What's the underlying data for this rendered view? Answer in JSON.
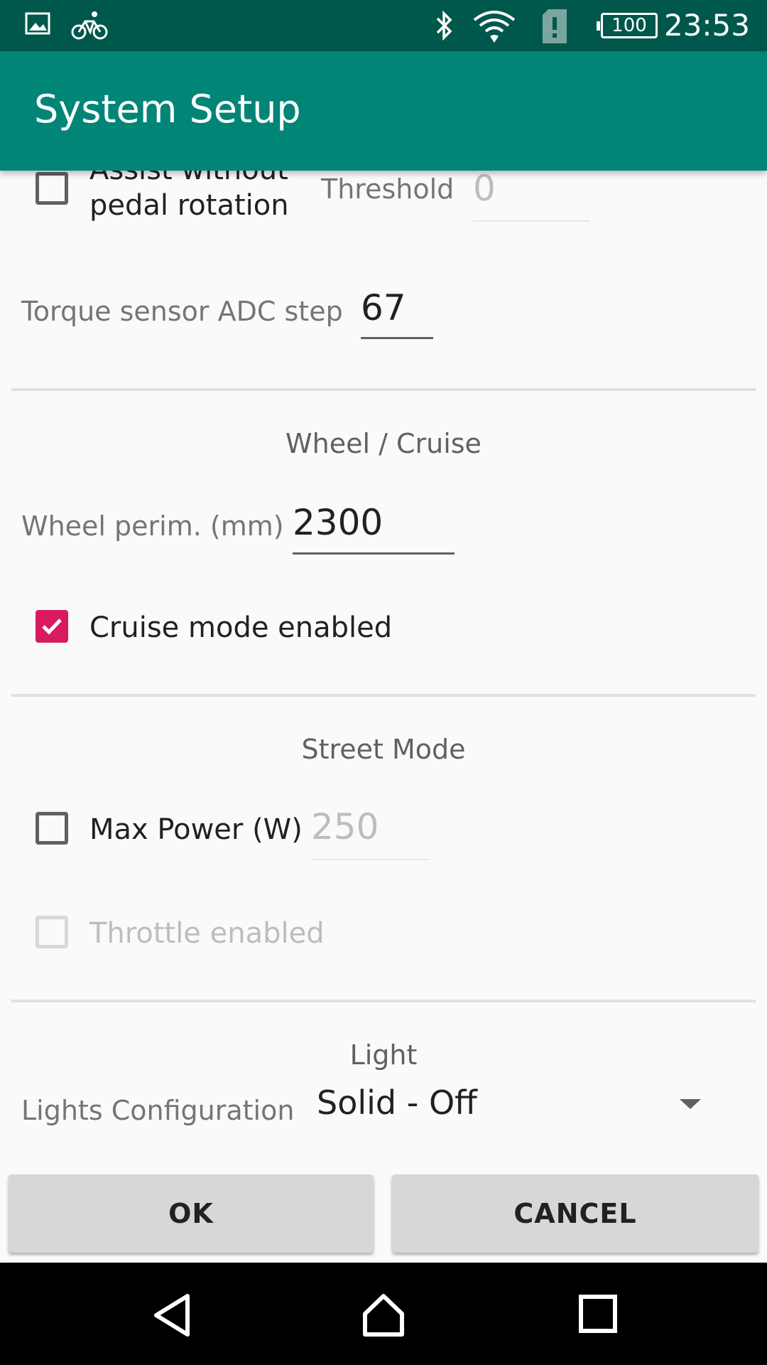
{
  "status_bar": {
    "icons_left": [
      "image-icon",
      "bicycle-icon"
    ],
    "icons_right": [
      "bluetooth-icon",
      "wifi-icon",
      "sim-alert-icon",
      "battery-icon"
    ],
    "battery_level": "100",
    "time": "23:53"
  },
  "app_bar": {
    "title": "System Setup"
  },
  "sections": {
    "torque": {
      "assist_label": "Assist without pedal rotation",
      "assist_checked": false,
      "threshold_label": "Threshold",
      "threshold_value": "0",
      "adc_step_label": "Torque sensor ADC step",
      "adc_step_value": "67"
    },
    "wheel_cruise": {
      "title": "Wheel / Cruise",
      "wheel_perim_label": "Wheel perim. (mm)",
      "wheel_perim_value": "2300",
      "cruise_label": "Cruise mode enabled",
      "cruise_checked": true
    },
    "street_mode": {
      "title": "Street Mode",
      "max_power_label": "Max Power (W)",
      "max_power_checked": false,
      "max_power_value": "250",
      "throttle_label": "Throttle enabled",
      "throttle_checked": false,
      "throttle_disabled": true
    },
    "light": {
      "title": "Light",
      "config_label": "Lights Configuration",
      "config_value": "Solid - Off"
    }
  },
  "buttons": {
    "ok": "OK",
    "cancel": "CANCEL"
  },
  "colors": {
    "status_bar": "#00574b",
    "app_bar": "#008577",
    "accent": "#d81b60",
    "button_bg": "#d6d7d7"
  },
  "nav_bar": {
    "icons": [
      "back-icon",
      "home-icon",
      "recents-icon"
    ]
  }
}
